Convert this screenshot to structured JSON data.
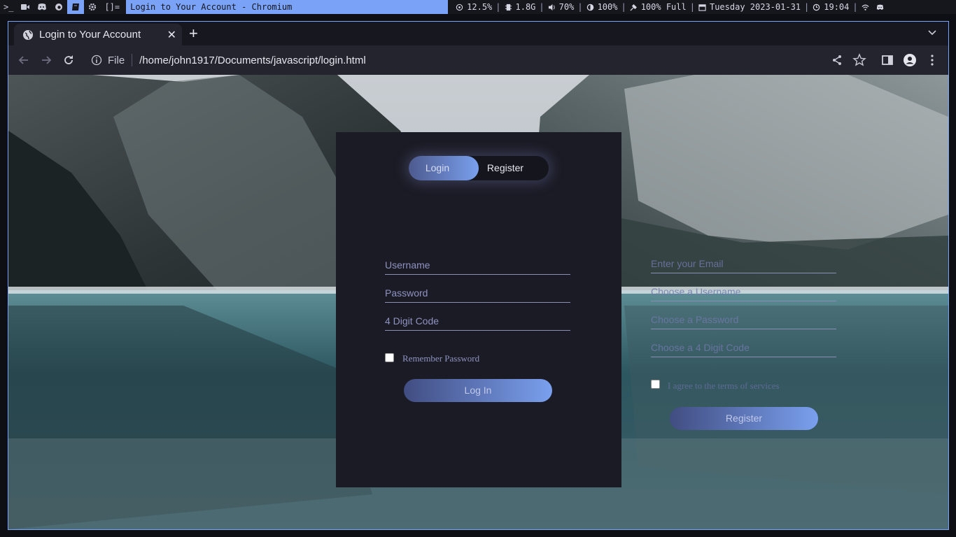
{
  "sysbar": {
    "workspaces": [
      ">_",
      "cam",
      "discord",
      "firefox",
      "chromium",
      "gear"
    ],
    "layout": "[]=",
    "window_title": "Login to Your Account - Chromium",
    "cpu": "12.5%",
    "memory": "1.8G",
    "volume": "70%",
    "brightness": "100%",
    "battery": "100% Full",
    "date": "Tuesday 2023-01-31",
    "time": "19:04"
  },
  "browser": {
    "tab_title": "Login to Your Account",
    "file_label": "File",
    "url": "/home/john1917/Documents/javascript/login.html"
  },
  "auth": {
    "toggle": {
      "login": "Login",
      "register": "Register"
    },
    "login": {
      "username_placeholder": "Username",
      "password_placeholder": "Password",
      "code_placeholder": "4 Digit Code",
      "remember_label": "Remember Password",
      "submit_label": "Log In"
    },
    "register": {
      "email_placeholder": "Enter your Email",
      "username_placeholder": "Choose a Username",
      "password_placeholder": "Choose a Password",
      "code_placeholder": "Choose a 4 Digit Code",
      "terms_label": "I agree to the terms of services",
      "submit_label": "Register"
    }
  },
  "colors": {
    "accent": "#7aa2f7",
    "card": "#1b1b25",
    "gradient_start": "#414d82",
    "gradient_end": "#7aa0ee"
  }
}
